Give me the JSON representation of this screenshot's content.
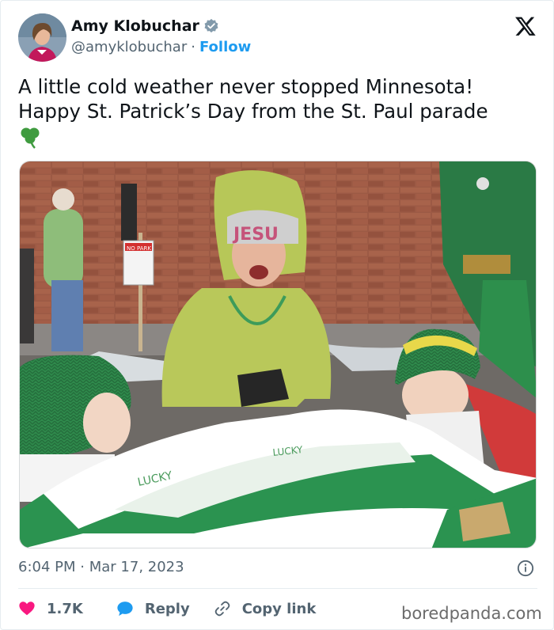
{
  "author": {
    "name": "Amy Klobuchar",
    "handle": "@amyklobuchar",
    "separator": "·",
    "follow_label": "Follow"
  },
  "tweet": {
    "line1": "A little cold weather never stopped Minnesota!",
    "line2": "Happy St. Patrick’s Day from the St. Paul parade",
    "emoji": "☘️"
  },
  "photo": {
    "sign_text": "NO PARKING TOW AWAY ZONE",
    "hat_text": "JESUS",
    "blanket_text": "LUCKY"
  },
  "meta": {
    "time": "6:04 PM",
    "separator": "·",
    "date": "Mar 17, 2023"
  },
  "actions": {
    "like_count": "1.7K",
    "reply_label": "Reply",
    "copy_label": "Copy link"
  },
  "watermark": "boredpanda.com",
  "colors": {
    "text": "#0f1419",
    "muted": "#536471",
    "link": "#1d9bf0",
    "like": "#f91880",
    "reply": "#1d9bf0"
  }
}
